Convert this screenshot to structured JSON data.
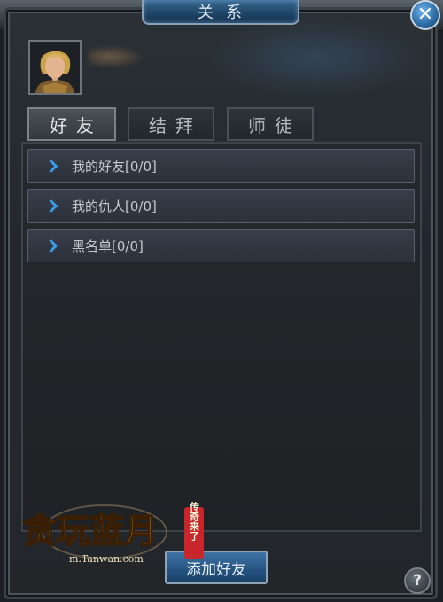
{
  "window": {
    "title": "关系",
    "close_icon": "close-icon",
    "help_label": "?"
  },
  "player": {
    "avatar": "player-portrait"
  },
  "tabs": [
    {
      "label": "好友",
      "active": true
    },
    {
      "label": "结拜",
      "active": false
    },
    {
      "label": "师徒",
      "active": false
    }
  ],
  "list": [
    {
      "label": "我的好友[0/0]"
    },
    {
      "label": "我的仇人[0/0]"
    },
    {
      "label": "黑名单[0/0]"
    }
  ],
  "actions": {
    "add_friend_label": "添加好友"
  },
  "watermark": {
    "main": "贪玩蓝月",
    "sub": "传奇来了",
    "url": "m.Tanwan.com"
  },
  "colors": {
    "accent_blue": "#3a9be6",
    "title_blue": "#1f4566",
    "logo_gold": "#e9b24a",
    "logo_red": "#c8262b"
  }
}
